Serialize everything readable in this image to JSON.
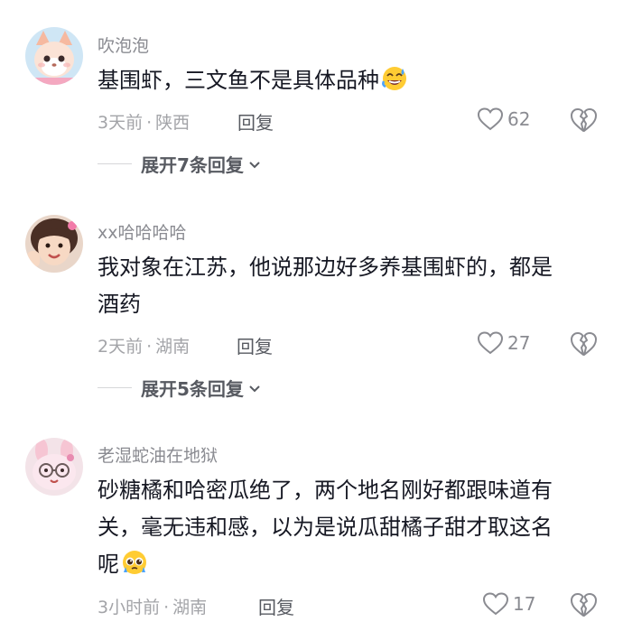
{
  "comments": [
    {
      "username": "吹泡泡",
      "text": "基围虾，三文鱼不是具体品种",
      "emoji_icon": "grinning-sweat-emoji",
      "time": "3天前",
      "separator": "·",
      "location": "陕西",
      "reply_label": "回复",
      "likes": "62",
      "expand_label": "展开7条回复"
    },
    {
      "username": "xx哈哈哈哈",
      "text_line1": "我对象在江苏，他说那边好多养基围虾的，都是",
      "text_line2": "酒药",
      "time": "2天前",
      "separator": "·",
      "location": "湖南",
      "reply_label": "回复",
      "likes": "27",
      "expand_label": "展开5条回复"
    },
    {
      "username": "老湿蛇油在地狱",
      "text_line1": "砂糖橘和哈密瓜绝了，两个地名刚好都跟味道有",
      "text_line2": "关，毫无违和感，以为是说瓜甜橘子甜才取这名",
      "text_line3": "呢",
      "emoji_icon": "pleading-face-emoji",
      "time": "3小时前",
      "separator": "·",
      "location": "湖南",
      "reply_label": "回复",
      "likes": "17"
    }
  ],
  "colors": {
    "text": "#161823",
    "secondary": "#8a8b91",
    "meta": "#a3a4a8",
    "action": "#575a61"
  }
}
